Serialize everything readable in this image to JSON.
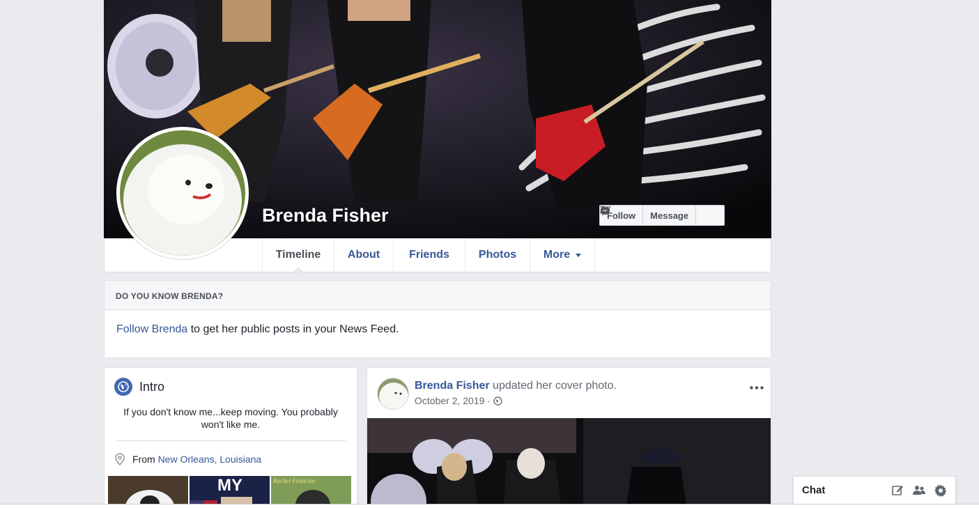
{
  "profile": {
    "name": "Brenda Fisher"
  },
  "cover_actions": {
    "follow": "Follow",
    "message": "Message",
    "more_icon": "ellipsis-icon"
  },
  "nav": {
    "tabs": [
      {
        "label": "Timeline",
        "active": true
      },
      {
        "label": "About"
      },
      {
        "label": "Friends"
      },
      {
        "label": "Photos"
      },
      {
        "label": "More"
      }
    ]
  },
  "know_box": {
    "header": "DO YOU KNOW BRENDA?",
    "link_text": "Follow Brenda",
    "rest_text": " to get her public posts in your News Feed."
  },
  "intro": {
    "title": "Intro",
    "bio": "If you don't know me...keep moving. You probably won't like me.",
    "from_label": "From ",
    "from_value": "New Orleans, Louisiana",
    "photo2_text": "MY",
    "photo3_text": "Rachel Francine"
  },
  "post": {
    "author": "Brenda Fisher",
    "action": " updated her cover photo.",
    "date": "October 2, 2019 ·"
  },
  "chat": {
    "label": "Chat"
  },
  "colors": {
    "link": "#365899",
    "background": "#e9ebee",
    "text": "#1d2129"
  }
}
